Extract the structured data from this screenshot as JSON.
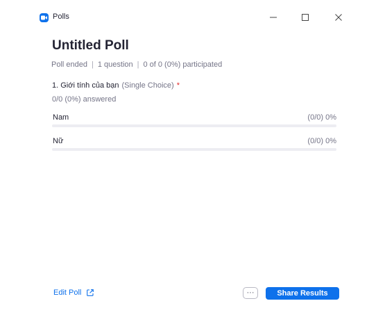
{
  "window": {
    "app_title": "Polls",
    "controls": {
      "minimize_icon": "minimize-icon",
      "maximize_icon": "maximize-icon",
      "close_icon": "close-icon"
    }
  },
  "poll": {
    "title": "Untitled Poll",
    "meta": {
      "status": "Poll ended",
      "questions": "1 question",
      "participation": "0 of 0 (0%) participated"
    },
    "question": {
      "text": "1. Giới tính của bạn",
      "type": "(Single Choice)",
      "required_marker": "*",
      "answered": "0/0 (0%) answered",
      "options": [
        {
          "label": "Nam",
          "stat": "(0/0) 0%",
          "fraction": 0
        },
        {
          "label": "Nữ",
          "stat": "(0/0) 0%",
          "fraction": 0
        }
      ]
    }
  },
  "footer": {
    "edit_label": "Edit Poll",
    "edit_icon": "external-link-icon",
    "more_label": "···",
    "share_label": "Share Results"
  },
  "colors": {
    "accent": "#0e71eb",
    "text_primary": "#232333",
    "text_secondary": "#747487",
    "required": "#e02828",
    "bar_track": "#ededf2"
  }
}
